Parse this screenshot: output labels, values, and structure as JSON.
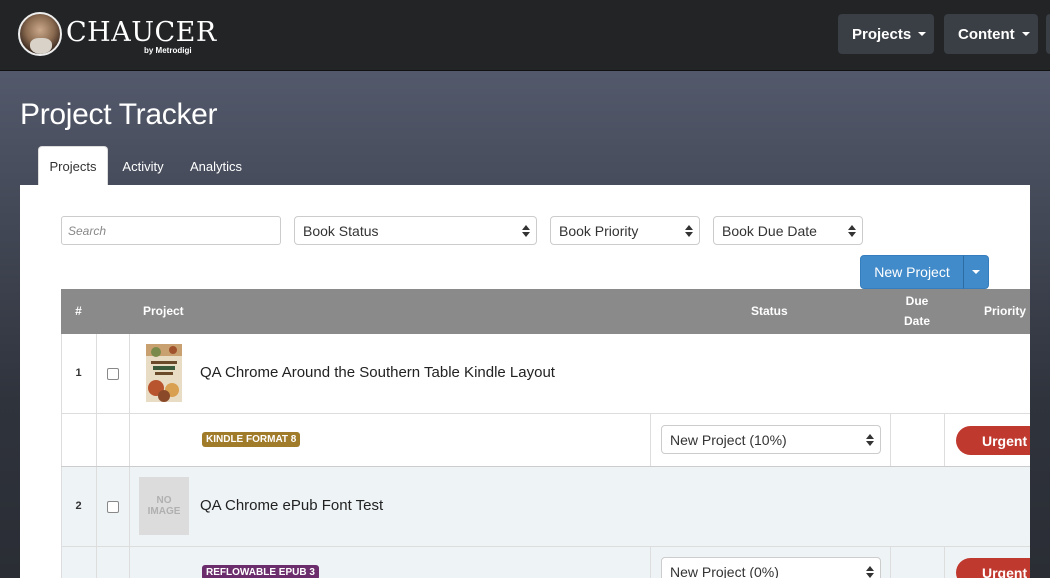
{
  "nav": {
    "logo_text": "CHAUCER",
    "logo_sub": "by Metrodigi",
    "menus": [
      {
        "label": "Projects"
      },
      {
        "label": "Content"
      }
    ]
  },
  "page": {
    "title": "Project Tracker",
    "tabs": [
      {
        "label": "Projects",
        "active": true
      },
      {
        "label": "Activity",
        "active": false
      },
      {
        "label": "Analytics",
        "active": false
      }
    ]
  },
  "filters": {
    "search_placeholder": "Search",
    "book_status": "Book Status",
    "book_priority": "Book Priority",
    "book_due_date": "Book Due Date"
  },
  "actions": {
    "new_project": "New Project"
  },
  "table": {
    "headers": {
      "num": "#",
      "project": "Project",
      "status": "Status",
      "due_date_line1": "Due",
      "due_date_line2": "Date",
      "priority": "Priority"
    },
    "rows": [
      {
        "num": "1",
        "title": "QA Chrome Around the Southern Table Kindle Layout",
        "format": "KINDLE FORMAT 8",
        "format_color": "#a07b2a",
        "status": "New Project (10%)",
        "priority": "Urgent",
        "thumb": "book-cover"
      },
      {
        "num": "2",
        "title": "QA Chrome ePub Font Test",
        "format": "REFLOWABLE EPUB 3",
        "format_color": "#6b2d6b",
        "status": "New Project (0%)",
        "priority": "Urgent",
        "thumb_line1": "NO",
        "thumb_line2": "IMAGE"
      }
    ]
  }
}
